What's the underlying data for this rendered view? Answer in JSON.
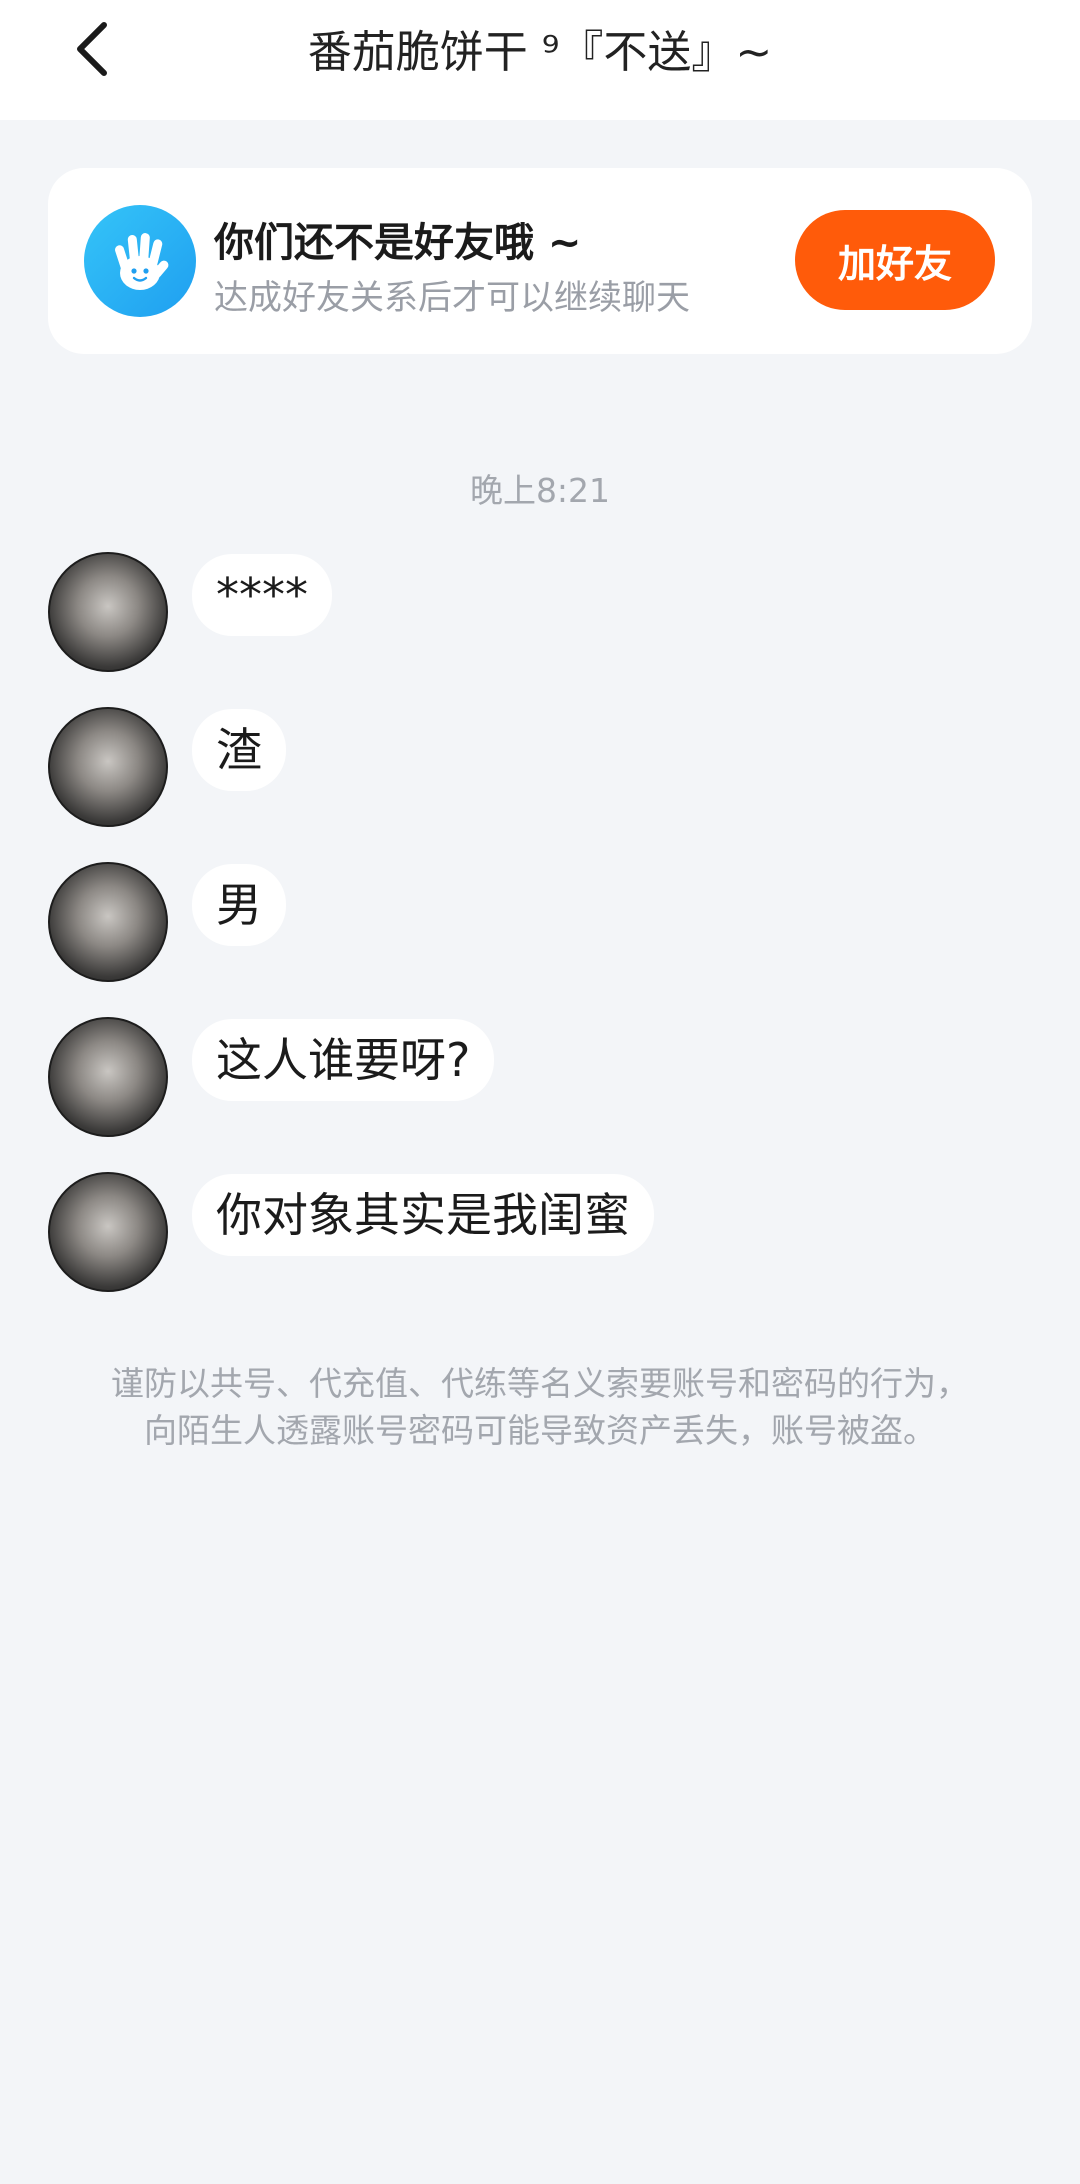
{
  "header": {
    "title": "番茄脆饼干 ⁹『不送』~",
    "back_icon": "chevron-left-icon"
  },
  "friend_notice": {
    "icon": "waving-hand-icon",
    "title": "你们还不是好友哦 ~",
    "subtitle": "达成好友关系后才可以继续聊天",
    "add_button": "加好友",
    "button_color": "#ff5b0a"
  },
  "chat": {
    "timestamp": "晚上8:21",
    "messages": [
      {
        "text": "****"
      },
      {
        "text": "渣"
      },
      {
        "text": "男"
      },
      {
        "text": "这人谁要呀?"
      },
      {
        "text": "你对象其实是我闺蜜"
      }
    ]
  },
  "safety_notice": "谨防以共号、代充值、代练等名义索要账号和密码的行为，向陌生人透露账号密码可能导致资产丢失，账号被盗。"
}
